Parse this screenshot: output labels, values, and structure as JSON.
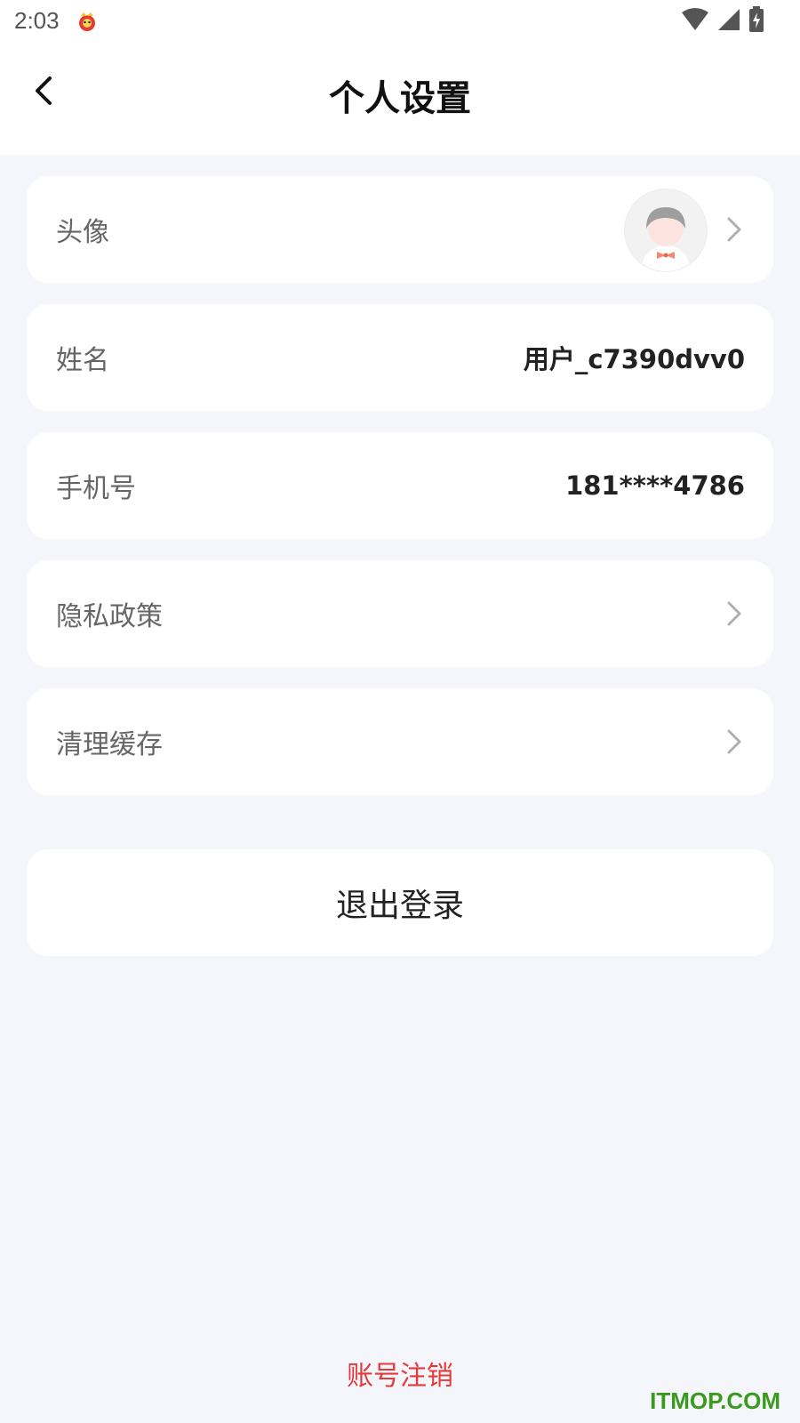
{
  "status_bar": {
    "time": "2:03",
    "app_icon": "mascot-icon",
    "icons": [
      "wifi-icon",
      "signal-icon",
      "battery-charging-icon"
    ]
  },
  "header": {
    "title": "个人设置",
    "back_icon": "back-arrow-icon"
  },
  "rows": {
    "avatar": {
      "label": "头像",
      "icon": "chevron-right-icon"
    },
    "name": {
      "label": "姓名",
      "value": "用户_c7390dvv0"
    },
    "phone": {
      "label": "手机号",
      "value": "181****4786"
    },
    "privacy": {
      "label": "隐私政策",
      "icon": "chevron-right-icon"
    },
    "cache": {
      "label": "清理缓存",
      "icon": "chevron-right-icon"
    }
  },
  "logout": {
    "label": "退出登录"
  },
  "cancel_account": {
    "label": "账号注销",
    "color": "#e5393a"
  },
  "watermark": {
    "text": "ITMOP.COM",
    "color": "#3a9a1e"
  },
  "colors": {
    "background": "#f5f6fb",
    "card": "#ffffff",
    "label": "#666666",
    "value": "#222222"
  }
}
